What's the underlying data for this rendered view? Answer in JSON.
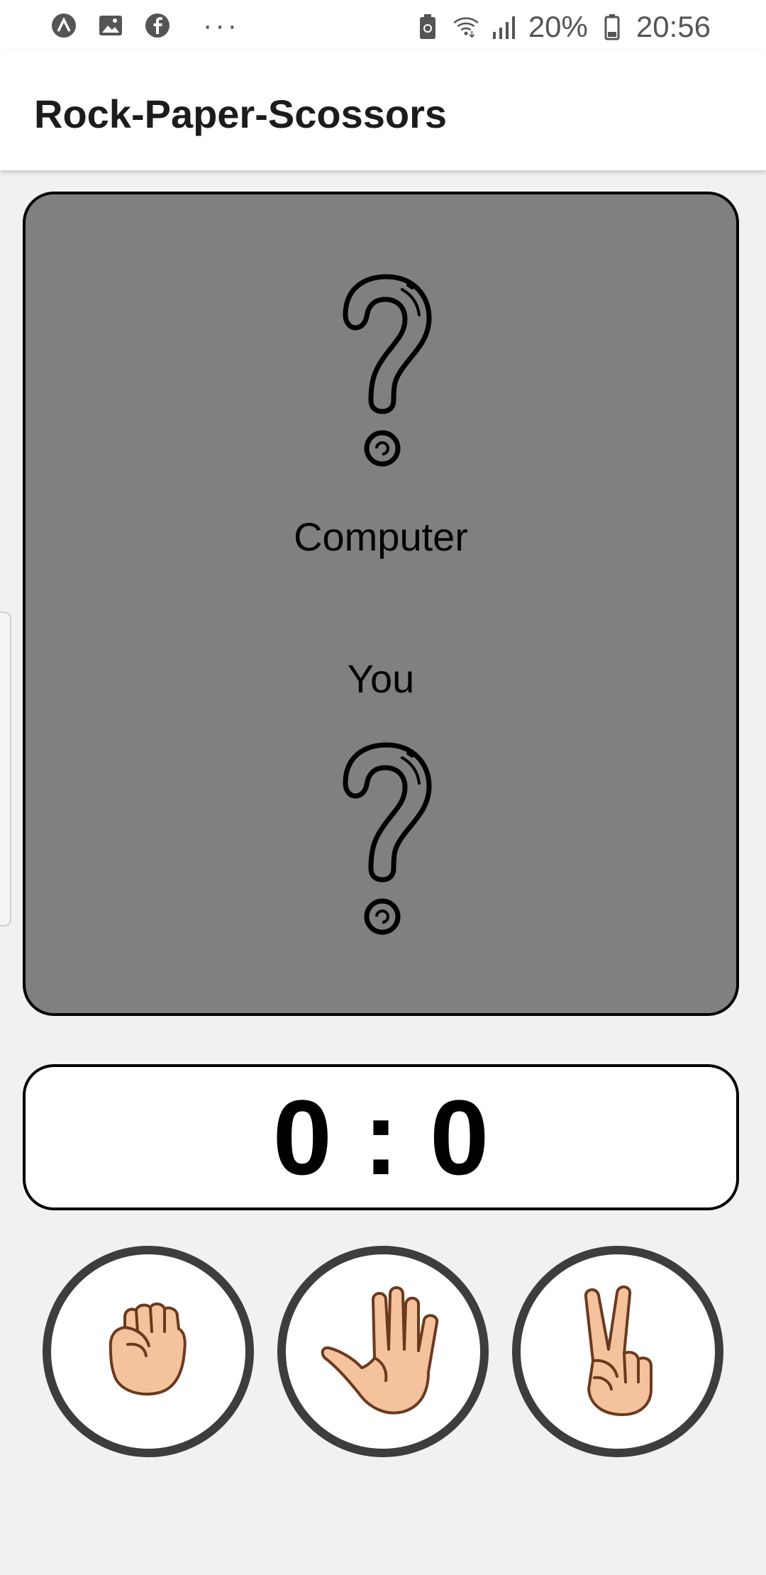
{
  "status_bar": {
    "battery_percent": "20%",
    "time": "20:56",
    "overflow_dots": "···"
  },
  "app_bar": {
    "title": "Rock-Paper-Scossors"
  },
  "board": {
    "computer_label": "Computer",
    "you_label": "You",
    "computer_choice_icon": "question-mark-icon",
    "you_choice_icon": "question-mark-icon"
  },
  "score": {
    "player": "0",
    "separator": ":",
    "computer": "0"
  },
  "choices": [
    {
      "icon": "rock-fist-icon"
    },
    {
      "icon": "paper-hand-icon"
    },
    {
      "icon": "scissors-hand-icon"
    }
  ],
  "colors": {
    "background": "#f1f1f1",
    "board": "#808080",
    "skin": "#f4c29c",
    "outline": "#6b3a1e",
    "button_ring": "#3d3d3d"
  }
}
